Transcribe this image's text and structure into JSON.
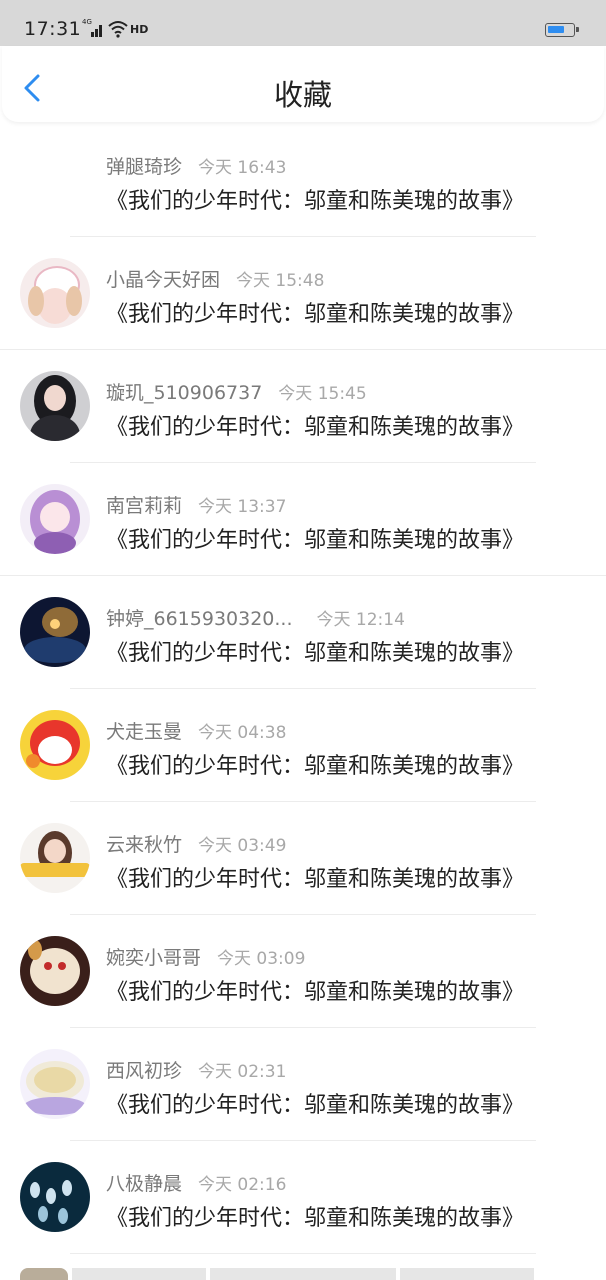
{
  "status_bar": {
    "time": "17:31",
    "signal_label": "4G",
    "hd_label": "HD"
  },
  "header": {
    "title": "收藏"
  },
  "items": [
    {
      "user": "弹腿琦珍",
      "time": "今天 16:43",
      "title": "《我们的少年时代：邬童和陈美瑰的故事》"
    },
    {
      "user": "小晶今天好困",
      "time": "今天 15:48",
      "title": "《我们的少年时代：邬童和陈美瑰的故事》"
    },
    {
      "user": "璇玑_510906737",
      "time": "今天 15:45",
      "title": "《我们的少年时代：邬童和陈美瑰的故事》"
    },
    {
      "user": "南宫莉莉",
      "time": "今天 13:37",
      "title": "《我们的少年时代：邬童和陈美瑰的故事》"
    },
    {
      "user": "钟婷_6615930320...",
      "time": "今天 12:14",
      "title": "《我们的少年时代：邬童和陈美瑰的故事》"
    },
    {
      "user": "犬走玉曼",
      "time": "今天 04:38",
      "title": "《我们的少年时代：邬童和陈美瑰的故事》"
    },
    {
      "user": "云来秋竹",
      "time": "今天 03:49",
      "title": "《我们的少年时代：邬童和陈美瑰的故事》"
    },
    {
      "user": "婉奕小哥哥",
      "time": "今天 03:09",
      "title": "《我们的少年时代：邬童和陈美瑰的故事》"
    },
    {
      "user": "西风初珍",
      "time": "今天 02:31",
      "title": "《我们的少年时代：邬童和陈美瑰的故事》"
    },
    {
      "user": "八极静晨",
      "time": "今天 02:16",
      "title": "《我们的少年时代：邬童和陈美瑰的故事》"
    }
  ]
}
